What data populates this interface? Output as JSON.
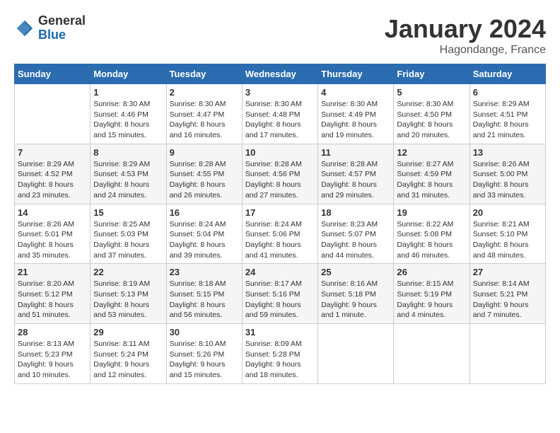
{
  "header": {
    "logo_general": "General",
    "logo_blue": "Blue",
    "month_title": "January 2024",
    "location": "Hagondange, France"
  },
  "weekdays": [
    "Sunday",
    "Monday",
    "Tuesday",
    "Wednesday",
    "Thursday",
    "Friday",
    "Saturday"
  ],
  "weeks": [
    [
      {
        "day": "",
        "sunrise": "",
        "sunset": "",
        "daylight": ""
      },
      {
        "day": "1",
        "sunrise": "Sunrise: 8:30 AM",
        "sunset": "Sunset: 4:46 PM",
        "daylight": "Daylight: 8 hours and 15 minutes."
      },
      {
        "day": "2",
        "sunrise": "Sunrise: 8:30 AM",
        "sunset": "Sunset: 4:47 PM",
        "daylight": "Daylight: 8 hours and 16 minutes."
      },
      {
        "day": "3",
        "sunrise": "Sunrise: 8:30 AM",
        "sunset": "Sunset: 4:48 PM",
        "daylight": "Daylight: 8 hours and 17 minutes."
      },
      {
        "day": "4",
        "sunrise": "Sunrise: 8:30 AM",
        "sunset": "Sunset: 4:49 PM",
        "daylight": "Daylight: 8 hours and 19 minutes."
      },
      {
        "day": "5",
        "sunrise": "Sunrise: 8:30 AM",
        "sunset": "Sunset: 4:50 PM",
        "daylight": "Daylight: 8 hours and 20 minutes."
      },
      {
        "day": "6",
        "sunrise": "Sunrise: 8:29 AM",
        "sunset": "Sunset: 4:51 PM",
        "daylight": "Daylight: 8 hours and 21 minutes."
      }
    ],
    [
      {
        "day": "7",
        "sunrise": "Sunrise: 8:29 AM",
        "sunset": "Sunset: 4:52 PM",
        "daylight": "Daylight: 8 hours and 23 minutes."
      },
      {
        "day": "8",
        "sunrise": "Sunrise: 8:29 AM",
        "sunset": "Sunset: 4:53 PM",
        "daylight": "Daylight: 8 hours and 24 minutes."
      },
      {
        "day": "9",
        "sunrise": "Sunrise: 8:28 AM",
        "sunset": "Sunset: 4:55 PM",
        "daylight": "Daylight: 8 hours and 26 minutes."
      },
      {
        "day": "10",
        "sunrise": "Sunrise: 8:28 AM",
        "sunset": "Sunset: 4:56 PM",
        "daylight": "Daylight: 8 hours and 27 minutes."
      },
      {
        "day": "11",
        "sunrise": "Sunrise: 8:28 AM",
        "sunset": "Sunset: 4:57 PM",
        "daylight": "Daylight: 8 hours and 29 minutes."
      },
      {
        "day": "12",
        "sunrise": "Sunrise: 8:27 AM",
        "sunset": "Sunset: 4:59 PM",
        "daylight": "Daylight: 8 hours and 31 minutes."
      },
      {
        "day": "13",
        "sunrise": "Sunrise: 8:26 AM",
        "sunset": "Sunset: 5:00 PM",
        "daylight": "Daylight: 8 hours and 33 minutes."
      }
    ],
    [
      {
        "day": "14",
        "sunrise": "Sunrise: 8:26 AM",
        "sunset": "Sunset: 5:01 PM",
        "daylight": "Daylight: 8 hours and 35 minutes."
      },
      {
        "day": "15",
        "sunrise": "Sunrise: 8:25 AM",
        "sunset": "Sunset: 5:03 PM",
        "daylight": "Daylight: 8 hours and 37 minutes."
      },
      {
        "day": "16",
        "sunrise": "Sunrise: 8:24 AM",
        "sunset": "Sunset: 5:04 PM",
        "daylight": "Daylight: 8 hours and 39 minutes."
      },
      {
        "day": "17",
        "sunrise": "Sunrise: 8:24 AM",
        "sunset": "Sunset: 5:06 PM",
        "daylight": "Daylight: 8 hours and 41 minutes."
      },
      {
        "day": "18",
        "sunrise": "Sunrise: 8:23 AM",
        "sunset": "Sunset: 5:07 PM",
        "daylight": "Daylight: 8 hours and 44 minutes."
      },
      {
        "day": "19",
        "sunrise": "Sunrise: 8:22 AM",
        "sunset": "Sunset: 5:08 PM",
        "daylight": "Daylight: 8 hours and 46 minutes."
      },
      {
        "day": "20",
        "sunrise": "Sunrise: 8:21 AM",
        "sunset": "Sunset: 5:10 PM",
        "daylight": "Daylight: 8 hours and 48 minutes."
      }
    ],
    [
      {
        "day": "21",
        "sunrise": "Sunrise: 8:20 AM",
        "sunset": "Sunset: 5:12 PM",
        "daylight": "Daylight: 8 hours and 51 minutes."
      },
      {
        "day": "22",
        "sunrise": "Sunrise: 8:19 AM",
        "sunset": "Sunset: 5:13 PM",
        "daylight": "Daylight: 8 hours and 53 minutes."
      },
      {
        "day": "23",
        "sunrise": "Sunrise: 8:18 AM",
        "sunset": "Sunset: 5:15 PM",
        "daylight": "Daylight: 8 hours and 56 minutes."
      },
      {
        "day": "24",
        "sunrise": "Sunrise: 8:17 AM",
        "sunset": "Sunset: 5:16 PM",
        "daylight": "Daylight: 8 hours and 59 minutes."
      },
      {
        "day": "25",
        "sunrise": "Sunrise: 8:16 AM",
        "sunset": "Sunset: 5:18 PM",
        "daylight": "Daylight: 9 hours and 1 minute."
      },
      {
        "day": "26",
        "sunrise": "Sunrise: 8:15 AM",
        "sunset": "Sunset: 5:19 PM",
        "daylight": "Daylight: 9 hours and 4 minutes."
      },
      {
        "day": "27",
        "sunrise": "Sunrise: 8:14 AM",
        "sunset": "Sunset: 5:21 PM",
        "daylight": "Daylight: 9 hours and 7 minutes."
      }
    ],
    [
      {
        "day": "28",
        "sunrise": "Sunrise: 8:13 AM",
        "sunset": "Sunset: 5:23 PM",
        "daylight": "Daylight: 9 hours and 10 minutes."
      },
      {
        "day": "29",
        "sunrise": "Sunrise: 8:11 AM",
        "sunset": "Sunset: 5:24 PM",
        "daylight": "Daylight: 9 hours and 12 minutes."
      },
      {
        "day": "30",
        "sunrise": "Sunrise: 8:10 AM",
        "sunset": "Sunset: 5:26 PM",
        "daylight": "Daylight: 9 hours and 15 minutes."
      },
      {
        "day": "31",
        "sunrise": "Sunrise: 8:09 AM",
        "sunset": "Sunset: 5:28 PM",
        "daylight": "Daylight: 9 hours and 18 minutes."
      },
      {
        "day": "",
        "sunrise": "",
        "sunset": "",
        "daylight": ""
      },
      {
        "day": "",
        "sunrise": "",
        "sunset": "",
        "daylight": ""
      },
      {
        "day": "",
        "sunrise": "",
        "sunset": "",
        "daylight": ""
      }
    ]
  ]
}
